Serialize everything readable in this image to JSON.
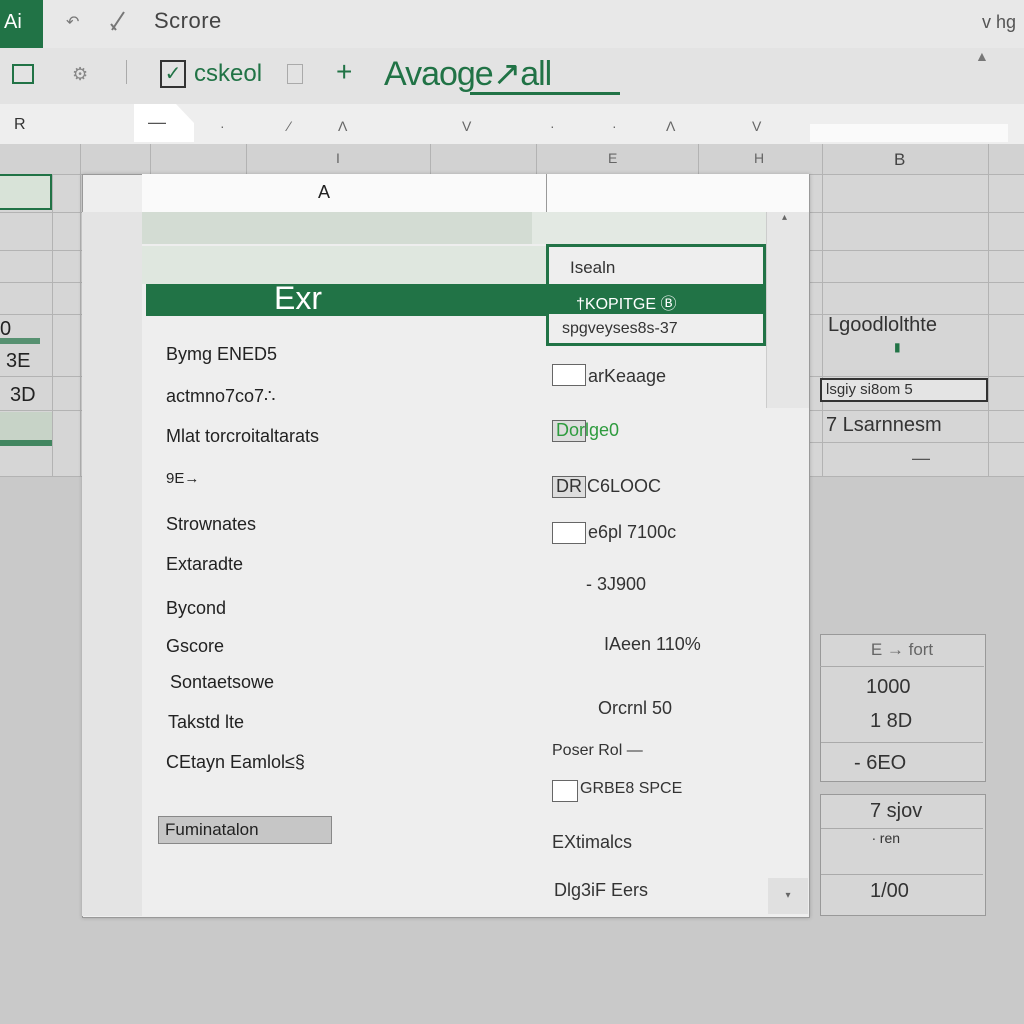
{
  "app": {
    "badge": "Ai",
    "title": "Scrore",
    "user": "v hg"
  },
  "toolbar": {
    "icons": [
      "undo-icon",
      "pen-icon"
    ],
    "checkbox_label": "cskeol",
    "plus": "+",
    "average_label": "Avaoge↗all"
  },
  "formula_bar": {
    "name_box": "R",
    "fx_dash": "—",
    "marks": [
      "·",
      "⁄",
      "Λ",
      "V",
      "·",
      "·",
      "Λ",
      "V"
    ]
  },
  "columns": {
    "i": "I",
    "e": "E",
    "h": "H",
    "b": "B"
  },
  "left_cells": [
    "0",
    "3E",
    "3D"
  ],
  "right_column": {
    "line1": "Lgoodlolthte",
    "boxed": "lsgiy  si8om 5",
    "line2": "7 Lsarnnesm",
    "dash": "—"
  },
  "dialog": {
    "header": "A",
    "highlight": "Exr",
    "green_box": {
      "top": "Isealn",
      "middle": "†KOPITGE  Ⓑ",
      "bottom": "spgveyses8s-37"
    },
    "left_labels": [
      "Bymg ENED5",
      "actmno7co7∴",
      "Mlat torcroitaltarats",
      "9E→",
      "Strownates",
      "Extaradte",
      "Bycond",
      "Gscore",
      "Sontaetsowe",
      "Takstd lte",
      "CEtayn Eamlol≤§"
    ],
    "footer_button": "Fuminatalon",
    "right_values": [
      "arKeaage",
      "Dorlge0",
      "DR  C6LOOC",
      "e6pl  7100c",
      "- 3J900",
      "IAeen 110%",
      "Orcrnl 50",
      "Poser Rol —",
      "GRBE8 SPCE",
      "EXtimalcs",
      "Dlg3iF Eers"
    ]
  },
  "table1": {
    "header": "E → fort",
    "rows": [
      "1000",
      "1 8D",
      "- 6EO"
    ]
  },
  "table2": {
    "rows": [
      "7 sjov",
      "∙ ren",
      "1/00"
    ]
  }
}
